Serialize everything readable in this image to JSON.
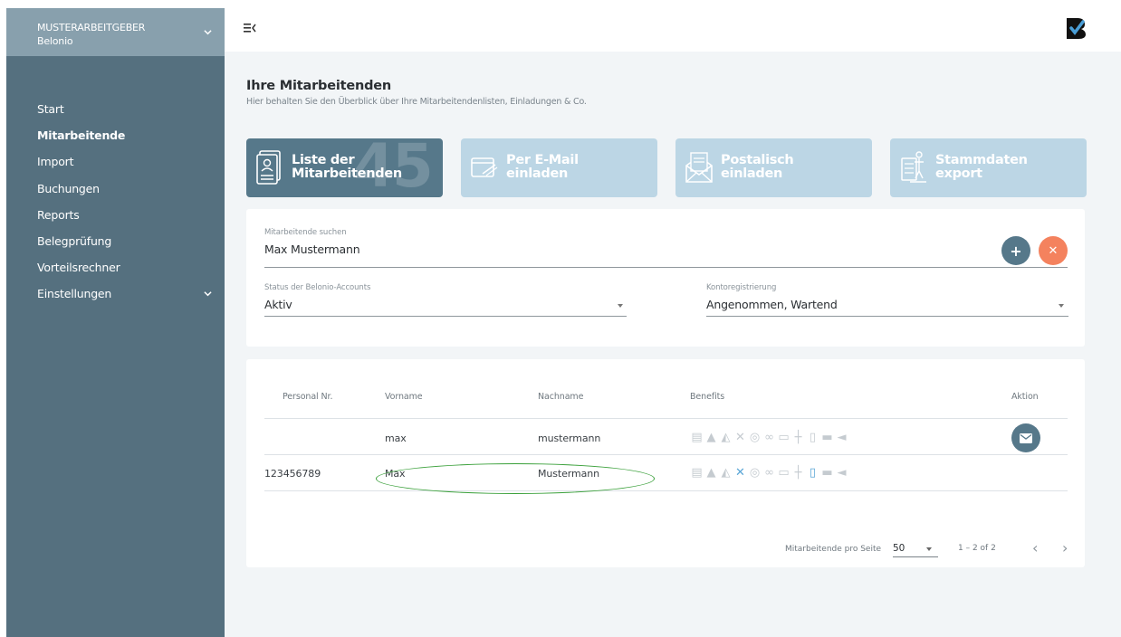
{
  "sidebar": {
    "org": {
      "line1": "MUSTERARBEITGEBER",
      "line2": "Belonio"
    },
    "items": [
      {
        "label": "Start"
      },
      {
        "label": "Mitarbeitende"
      },
      {
        "label": "Import"
      },
      {
        "label": "Buchungen"
      },
      {
        "label": "Reports"
      },
      {
        "label": "Belegprüfung"
      },
      {
        "label": "Vorteilsrechner"
      },
      {
        "label": "Einstellungen"
      }
    ]
  },
  "header": {
    "title": "Ihre Mitarbeitenden",
    "subtitle": "Hier behalten Sie den Überblick über Ihre Mitarbeitendenlisten, Einladungen & Co."
  },
  "cards": [
    {
      "label": "Liste der\nMitarbeitenden",
      "count": "45"
    },
    {
      "label": "Per E-Mail\neinladen"
    },
    {
      "label": "Postalisch\neinladen"
    },
    {
      "label": "Stammdaten\nexport"
    }
  ],
  "search": {
    "label": "Mitarbeitende suchen",
    "value": "Max Mustermann",
    "add_symbol": "+",
    "clear_symbol": "✕"
  },
  "filters": {
    "status": {
      "label": "Status der Belonio-Accounts",
      "value": "Aktiv"
    },
    "registration": {
      "label": "Kontoregistrierung",
      "value": "Angenommen, Wartend"
    }
  },
  "table": {
    "headers": {
      "personal": "Personal Nr.",
      "vorname": "Vorname",
      "nachname": "Nachname",
      "benefits": "Benefits",
      "aktion": "Aktion"
    },
    "rows": [
      {
        "personal": "",
        "vorname": "max",
        "nachname": "mustermann"
      },
      {
        "personal": "123456789",
        "vorname": "Max",
        "nachname": "Mustermann"
      }
    ]
  },
  "pagination": {
    "per_page_label": "Mitarbeitende pro Seite",
    "per_page_value": "50",
    "range": "1 – 2 of 2",
    "prev": "‹",
    "next": "›"
  },
  "colors": {
    "sidebar": "#55707f",
    "accent": "#56788a",
    "card_inactive": "#bcd6e5",
    "clear": "#f4825e",
    "highlight": "#3aa03a",
    "benefit_active": "#5aa6d6"
  }
}
